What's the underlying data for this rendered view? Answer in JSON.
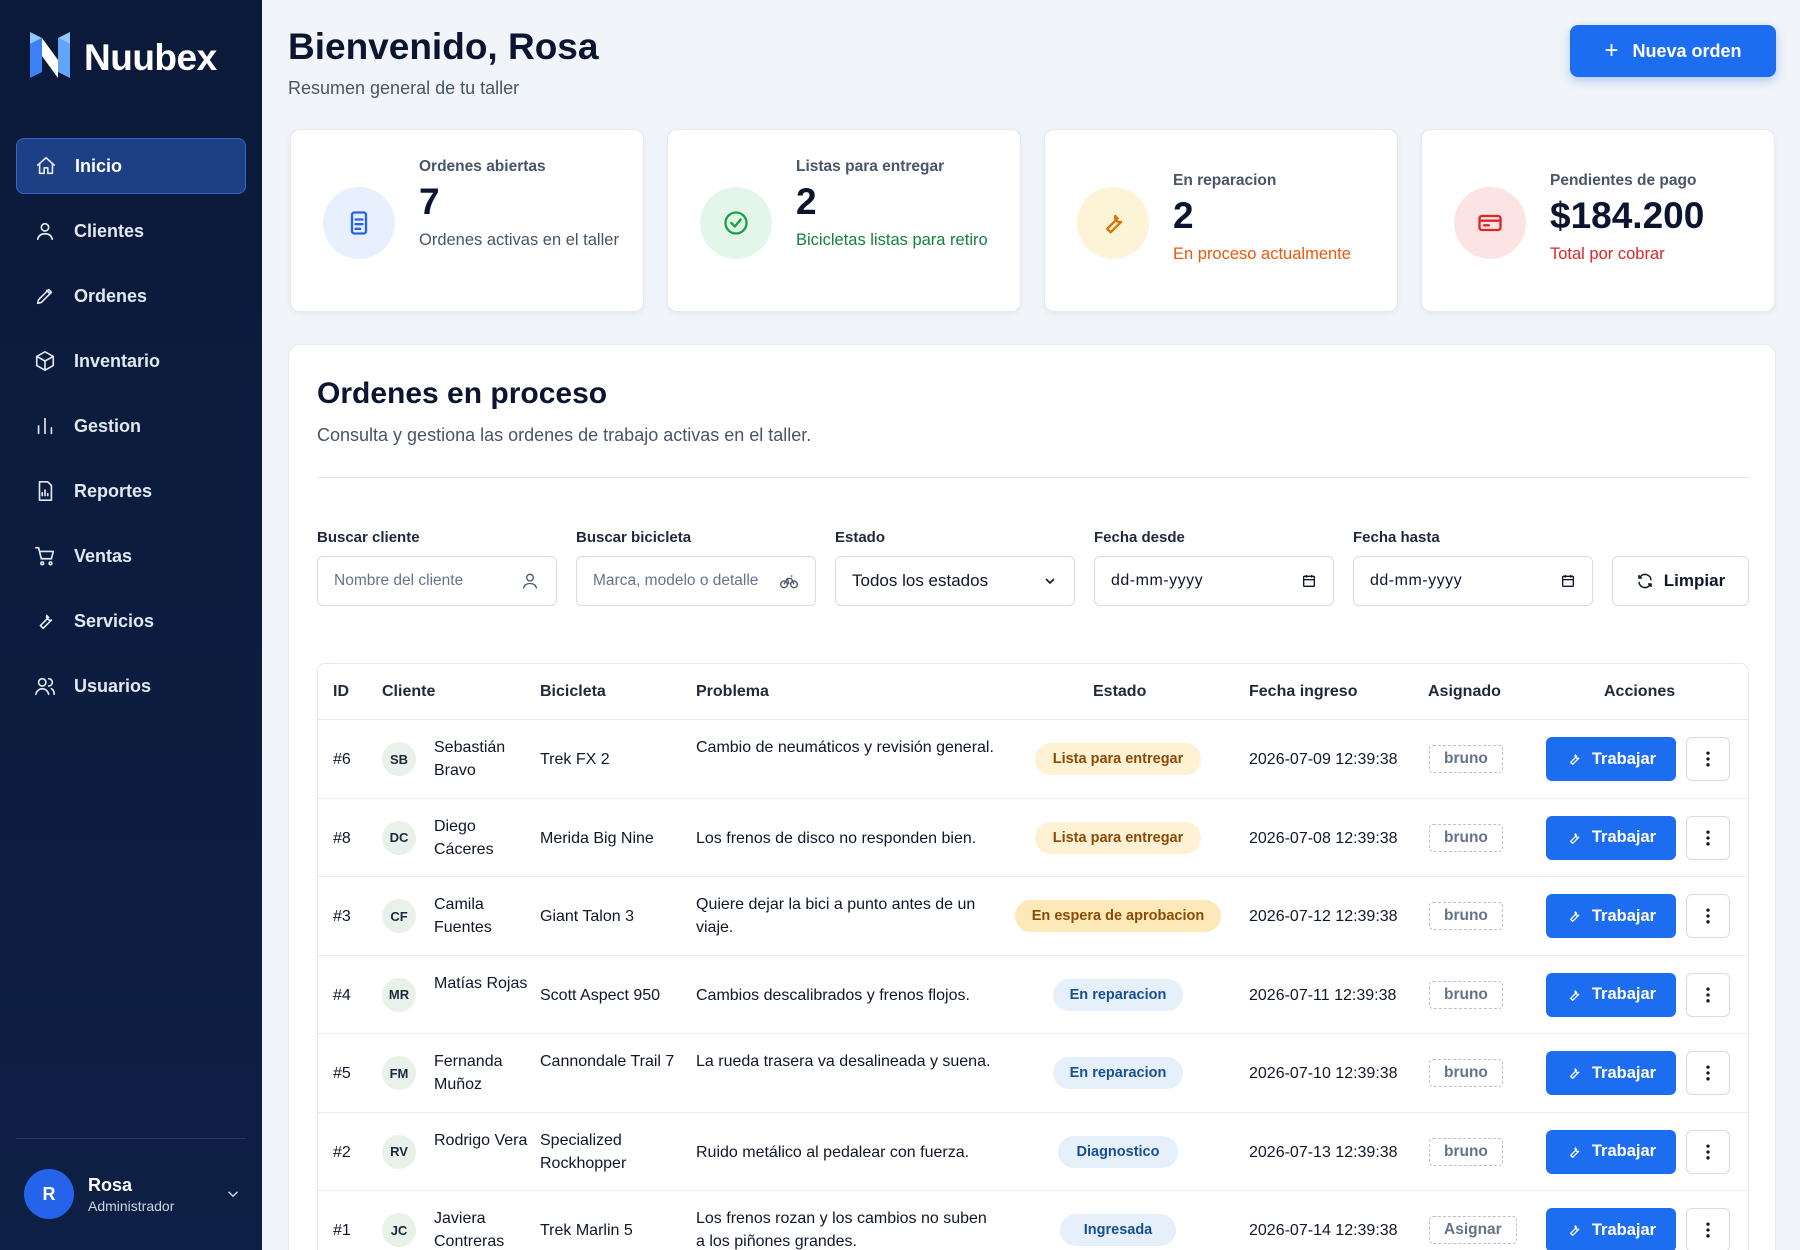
{
  "brand": {
    "name": "Nuubex"
  },
  "sidebar": {
    "items": [
      {
        "key": "inicio",
        "label": "Inicio",
        "active": true
      },
      {
        "key": "clientes",
        "label": "Clientes"
      },
      {
        "key": "ordenes",
        "label": "Ordenes"
      },
      {
        "key": "inventario",
        "label": "Inventario"
      },
      {
        "key": "gestion",
        "label": "Gestion"
      },
      {
        "key": "reportes",
        "label": "Reportes"
      },
      {
        "key": "ventas",
        "label": "Ventas"
      },
      {
        "key": "servicios",
        "label": "Servicios"
      },
      {
        "key": "usuarios",
        "label": "Usuarios"
      }
    ],
    "user": {
      "initial": "R",
      "name": "Rosa",
      "role": "Administrador"
    }
  },
  "header": {
    "title": "Bienvenido, Rosa",
    "subtitle": "Resumen general de tu taller",
    "new_order_label": "Nueva orden"
  },
  "stats": [
    {
      "label": "Ordenes abiertas",
      "value": "7",
      "desc": "Ordenes activas en el taller",
      "color": "#475569"
    },
    {
      "label": "Listas para entregar",
      "value": "2",
      "desc": "Bicicletas listas para retiro",
      "color": "#15803d"
    },
    {
      "label": "En reparacion",
      "value": "2",
      "desc": "En proceso actualmente",
      "color": "#ea580c"
    },
    {
      "label": "Pendientes de pago",
      "value": "$184.200",
      "desc": "Total por cobrar",
      "color": "#dc2626"
    }
  ],
  "panel": {
    "title": "Ordenes en proceso",
    "subtitle": "Consulta y gestiona las ordenes de trabajo activas en el taller."
  },
  "filters": {
    "cliente": {
      "label": "Buscar cliente",
      "placeholder": "Nombre del cliente"
    },
    "bicicleta": {
      "label": "Buscar bicicleta",
      "placeholder": "Marca, modelo o detalle"
    },
    "estado": {
      "label": "Estado",
      "value": "Todos los estados"
    },
    "desde": {
      "label": "Fecha desde",
      "value": "dd-mm-yyyy"
    },
    "hasta": {
      "label": "Fecha hasta",
      "value": "dd-mm-yyyy"
    },
    "clear_label": "Limpiar"
  },
  "table": {
    "headers": {
      "id": "ID",
      "cliente": "Cliente",
      "bicicleta": "Bicicleta",
      "problema": "Problema",
      "estado": "Estado",
      "fecha": "Fecha ingreso",
      "asignado": "Asignado",
      "acciones": "Acciones"
    },
    "work_label": "Trabajar",
    "rows": [
      {
        "id": "#6",
        "initials": "SB",
        "client": "Sebastián Bravo",
        "bike": "Trek FX 2",
        "problem": "Cambio de neumáticos y revisión general.",
        "status": "Lista para entregar",
        "status_kind": "ready",
        "date": "2026-07-09 12:39:38",
        "assigned": "bruno"
      },
      {
        "id": "#8",
        "initials": "DC",
        "client": "Diego Cáceres",
        "bike": "Merida Big Nine",
        "problem": "Los frenos de disco no responden bien.",
        "status": "Lista para entregar",
        "status_kind": "ready",
        "date": "2026-07-08 12:39:38",
        "assigned": "bruno"
      },
      {
        "id": "#3",
        "initials": "CF",
        "client": "Camila Fuentes",
        "bike": "Giant Talon 3",
        "problem": "Quiere dejar la bici a punto antes de un viaje.",
        "status": "En espera de aprobacion",
        "status_kind": "wait",
        "date": "2026-07-12 12:39:38",
        "assigned": "bruno"
      },
      {
        "id": "#4",
        "initials": "MR",
        "client": "Matías Rojas",
        "bike": "Scott Aspect 950",
        "problem": "Cambios descalibrados y frenos flojos.",
        "status": "En reparacion",
        "status_kind": "repair",
        "date": "2026-07-11 12:39:38",
        "assigned": "bruno"
      },
      {
        "id": "#5",
        "initials": "FM",
        "client": "Fernanda Muñoz",
        "bike": "Cannondale Trail 7",
        "problem": "La rueda trasera va desalineada y suena.",
        "status": "En reparacion",
        "status_kind": "repair",
        "date": "2026-07-10 12:39:38",
        "assigned": "bruno"
      },
      {
        "id": "#2",
        "initials": "RV",
        "client": "Rodrigo Vera",
        "bike": "Specialized Rockhopper",
        "problem": "Ruido metálico al pedalear con fuerza.",
        "status": "Diagnostico",
        "status_kind": "diag",
        "date": "2026-07-13 12:39:38",
        "assigned": "bruno"
      },
      {
        "id": "#1",
        "initials": "JC",
        "client": "Javiera Contreras",
        "bike": "Trek Marlin 5",
        "problem": "Los frenos rozan y los cambios no suben a los piñones grandes.",
        "status": "Ingresada",
        "status_kind": "in",
        "date": "2026-07-14 12:39:38",
        "assigned": "Asignar"
      }
    ]
  },
  "colors": {
    "primary": "#1d6df0",
    "sidebar": "#0b1a3a"
  }
}
